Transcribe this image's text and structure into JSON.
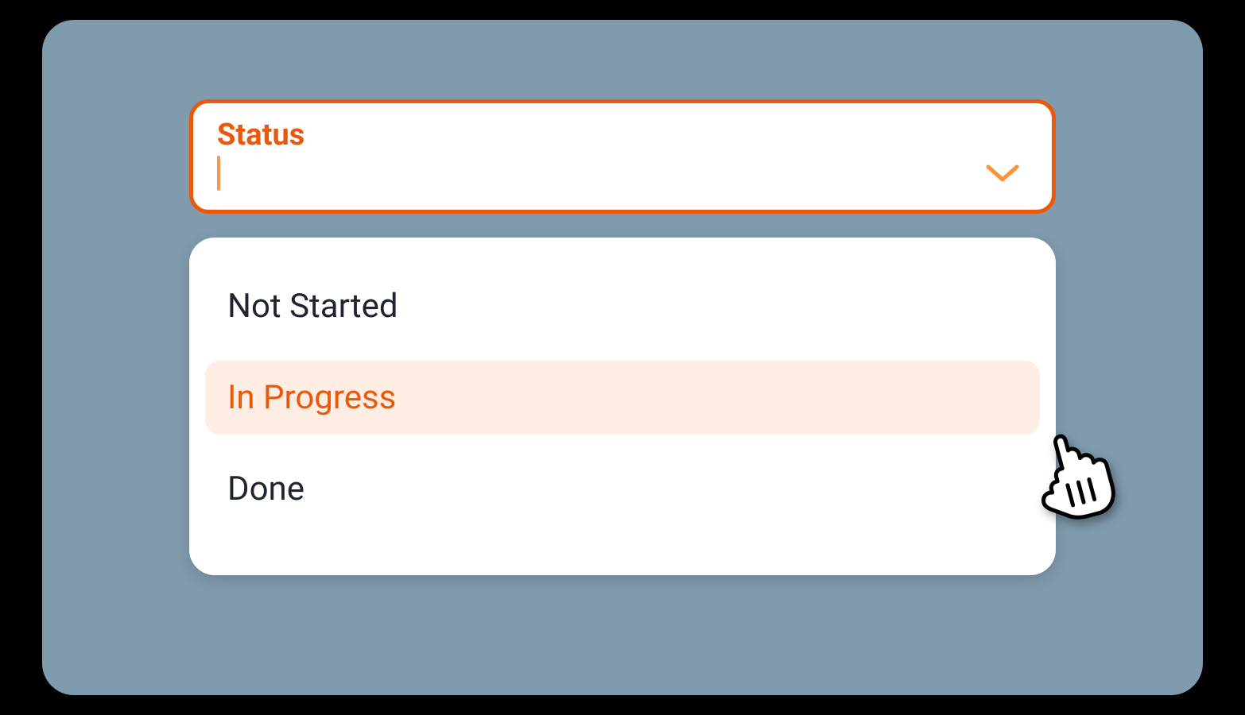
{
  "select": {
    "label": "Status",
    "value": "",
    "expanded": true
  },
  "options": [
    {
      "label": "Not Started",
      "highlighted": false
    },
    {
      "label": "In Progress",
      "highlighted": true
    },
    {
      "label": "Done",
      "highlighted": false
    }
  ],
  "colors": {
    "accent": "#ea580c",
    "accent_light": "#fb923c",
    "highlight_bg": "#feede2",
    "canvas_bg": "#809bae",
    "text": "#1e2530"
  }
}
